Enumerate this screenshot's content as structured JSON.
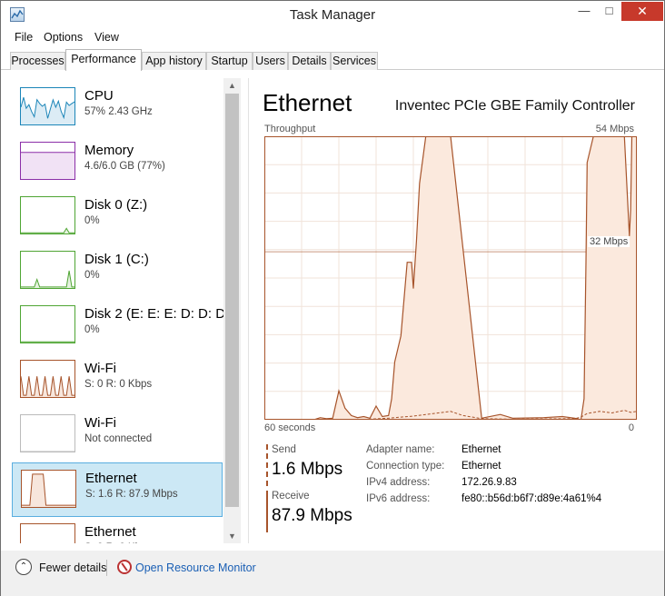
{
  "window": {
    "title": "Task Manager"
  },
  "menu": [
    "File",
    "Options",
    "View"
  ],
  "tabs": [
    "Processes",
    "Performance",
    "App history",
    "Startup",
    "Users",
    "Details",
    "Services"
  ],
  "active_tab": "Performance",
  "devices": [
    {
      "name": "CPU",
      "sub": "57%  2.43 GHz",
      "color": "#1b85b8",
      "fill": "#dcecf5",
      "selected": false
    },
    {
      "name": "Memory",
      "sub": "4.6/6.0 GB (77%)",
      "color": "#8b2fa8",
      "fill": "#f1e2f5",
      "selected": false
    },
    {
      "name": "Disk 0 (Z:)",
      "sub": "0%",
      "color": "#4fa533",
      "fill": "#e5f2df",
      "selected": false
    },
    {
      "name": "Disk 1 (C:)",
      "sub": "0%",
      "color": "#4fa533",
      "fill": "#e5f2df",
      "selected": false
    },
    {
      "name": "Disk 2 (E: E: E: D: D: D:)",
      "sub": "0%",
      "color": "#4fa533",
      "fill": "#e5f2df",
      "selected": false
    },
    {
      "name": "Wi-Fi",
      "sub": "S: 0 R: 0 Kbps",
      "color": "#a7542b",
      "fill": "#f7e6dc",
      "selected": false
    },
    {
      "name": "Wi-Fi",
      "sub": "Not connected",
      "color": "#bbbbbb",
      "fill": "#f4f4f4",
      "selected": false
    },
    {
      "name": "Ethernet",
      "sub": "S: 1.6  R: 87.9 Mbps",
      "color": "#a7542b",
      "fill": "#f7e6dc",
      "selected": true
    },
    {
      "name": "Ethernet",
      "sub": "S: 0 R: 0 Kbps",
      "color": "#a7542b",
      "fill": "#f7e6dc",
      "selected": false
    }
  ],
  "main": {
    "title": "Ethernet",
    "adapter": "Inventec PCIe GBE Family Controller",
    "chart_top_left": "Throughput",
    "chart_top_right": "54 Mbps",
    "chart_mid": "32 Mbps",
    "chart_bottom_left": "60 seconds",
    "chart_bottom_right": "0",
    "line_color": "#a7542b",
    "fill_color": "#fbe9dd"
  },
  "chart_data": {
    "type": "area",
    "title": "Throughput",
    "xlabel": "",
    "ylabel": "",
    "xlim": [
      60,
      0
    ],
    "ylim": [
      0,
      54
    ],
    "grid": true,
    "series": [
      {
        "name": "Receive",
        "x": [
          60,
          52,
          51,
          50,
          49,
          48,
          47,
          46,
          45,
          44,
          43,
          42,
          41,
          40,
          39.5,
          39,
          38,
          37,
          36.3,
          36,
          35.5,
          35,
          34,
          33,
          32,
          31.5,
          31,
          30,
          25,
          22,
          20,
          15,
          12,
          10,
          9,
          8.5,
          8.2,
          8,
          7,
          6,
          5,
          4.5,
          4,
          3,
          2,
          1.2,
          1,
          0.8,
          0.5,
          0
        ],
        "values": [
          0,
          0,
          0.4,
          0.2,
          0.3,
          5.5,
          2.2,
          0.8,
          0.4,
          0.6,
          0.3,
          2.6,
          0.6,
          0.8,
          4,
          11,
          16,
          30,
          30,
          25,
          34,
          45,
          54,
          54,
          54,
          54,
          54,
          54,
          0.3,
          1,
          0.3,
          0.4,
          0.6,
          0.3,
          0,
          4,
          30,
          49,
          54,
          54,
          54,
          54,
          54,
          54,
          54,
          35,
          40,
          54,
          54,
          54
        ]
      },
      {
        "name": "Send",
        "x": [
          60,
          45,
          40,
          38,
          36,
          34,
          32,
          30,
          28,
          25,
          20,
          10,
          9,
          8,
          6,
          4,
          2,
          1,
          0
        ],
        "values": [
          0,
          0,
          0.3,
          0.5,
          0.7,
          1.0,
          1.3,
          1.6,
          0.8,
          0.2,
          0.1,
          0.2,
          0.5,
          1.2,
          1.6,
          1.3,
          1.8,
          1.4,
          1.6
        ]
      }
    ]
  },
  "stats": {
    "send_label": "Send",
    "send_value": "1.6 Mbps",
    "receive_label": "Receive",
    "receive_value": "87.9 Mbps"
  },
  "properties": [
    {
      "key": "Adapter name:",
      "value": "Ethernet"
    },
    {
      "key": "Connection type:",
      "value": "Ethernet"
    },
    {
      "key": "IPv4 address:",
      "value": "172.26.9.83"
    },
    {
      "key": "IPv6 address:",
      "value": "fe80::b56d:b6f7:d89e:4a61%4"
    }
  ],
  "footer": {
    "fewer_details": "Fewer details",
    "open_resource_monitor": "Open Resource Monitor"
  }
}
